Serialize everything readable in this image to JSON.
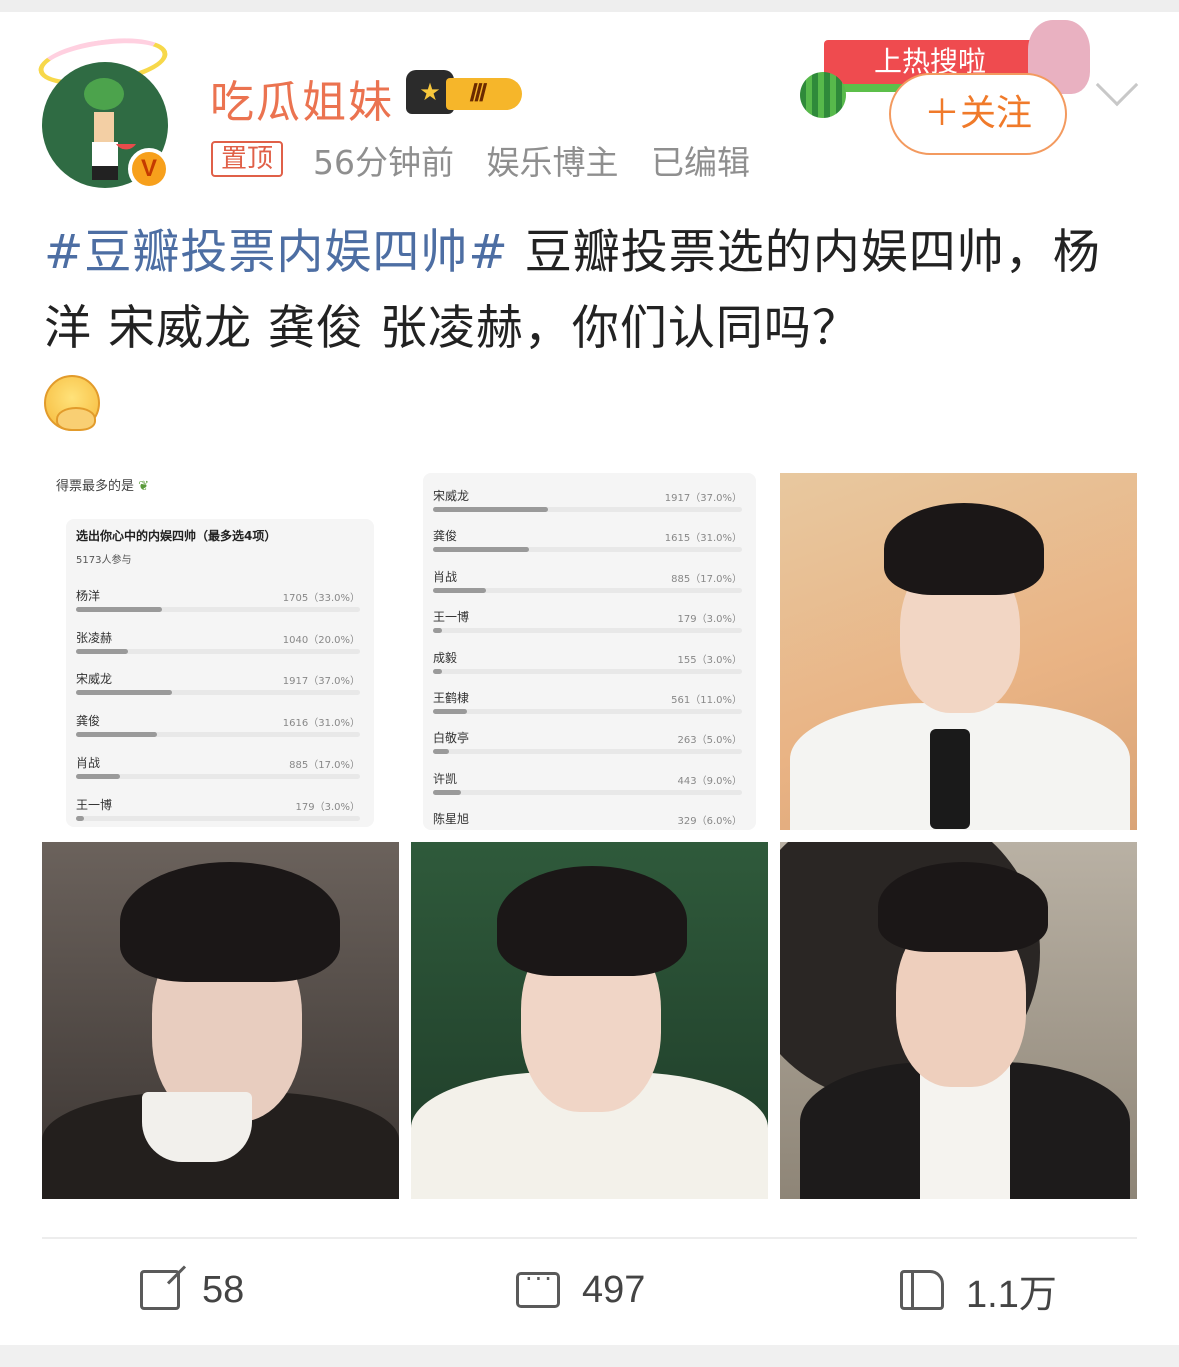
{
  "header": {
    "username": "吃瓜姐妹",
    "level_label": "Ⅲ",
    "pinned_label": "置顶",
    "time": "56分钟前",
    "category": "娱乐博主",
    "edited": "已编辑",
    "hot_banner": "上热搜啦",
    "follow_label": "＋关注",
    "verified_label": "V"
  },
  "post": {
    "hashtag": "#豆瓣投票内娱四帅#",
    "body": " 豆瓣投票选的内娱四帅，杨洋 宋威龙 龚俊 张凌赫，你们认同吗？"
  },
  "poll1": {
    "heading": "得票最多的是",
    "title": "选出你心中的内娱四帅（最多选4项）",
    "participants": "5173人参与",
    "rows": [
      {
        "name": "杨洋",
        "value": "1705（33.0%）",
        "pct": 0.33
      },
      {
        "name": "张凌赫",
        "value": "1040（20.0%）",
        "pct": 0.2
      },
      {
        "name": "宋威龙",
        "value": "1917（37.0%）",
        "pct": 0.37
      },
      {
        "name": "龚俊",
        "value": "1616（31.0%）",
        "pct": 0.31
      },
      {
        "name": "肖战",
        "value": "885（17.0%）",
        "pct": 0.17
      },
      {
        "name": "王一博",
        "value": "179（3.0%）",
        "pct": 0.03
      }
    ]
  },
  "poll2": {
    "rows": [
      {
        "name": "宋威龙",
        "value": "1917（37.0%）",
        "pct": 0.37
      },
      {
        "name": "龚俊",
        "value": "1615（31.0%）",
        "pct": 0.31
      },
      {
        "name": "肖战",
        "value": "885（17.0%）",
        "pct": 0.17
      },
      {
        "name": "王一博",
        "value": "179（3.0%）",
        "pct": 0.03
      },
      {
        "name": "成毅",
        "value": "155（3.0%）",
        "pct": 0.03
      },
      {
        "name": "王鹤棣",
        "value": "561（11.0%）",
        "pct": 0.11
      },
      {
        "name": "白敬亭",
        "value": "263（5.0%）",
        "pct": 0.05
      },
      {
        "name": "许凯",
        "value": "443（9.0%）",
        "pct": 0.09
      },
      {
        "name": "陈星旭",
        "value": "329（6.0%）",
        "pct": 0.06
      }
    ]
  },
  "actions": {
    "share_count": "58",
    "comment_count": "497",
    "like_count": "1.1万"
  },
  "colors": {
    "username": "#eb7350",
    "hashtag": "#4d6ea3",
    "follow": "#f07a2a"
  }
}
